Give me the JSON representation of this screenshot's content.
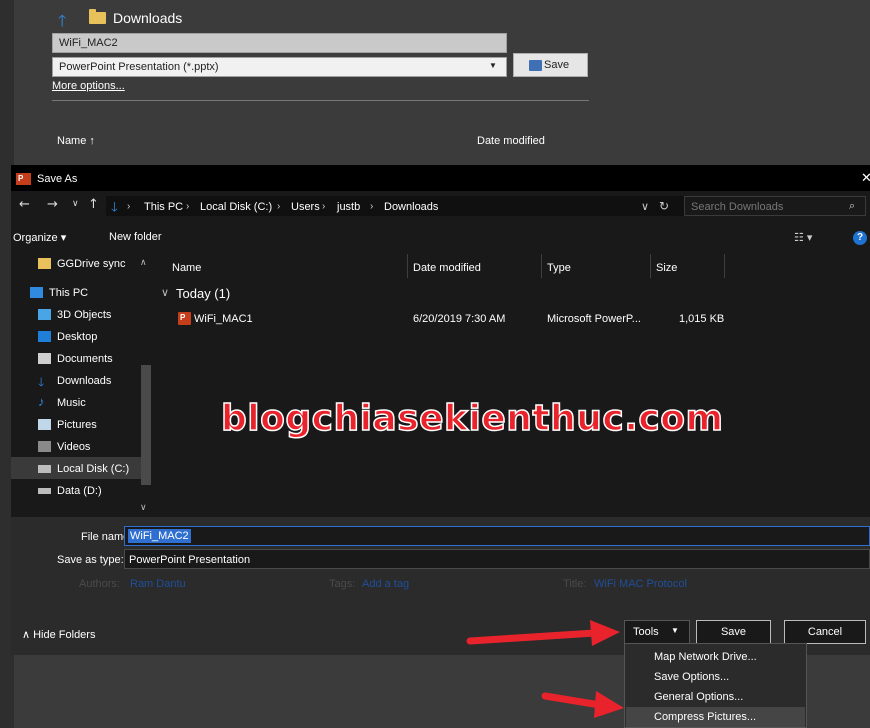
{
  "background": {
    "location": "Downloads",
    "file_name": "WiFi_MAC2",
    "file_type": "PowerPoint Presentation (*.pptx)",
    "save_label": "Save",
    "more_options": "More options...",
    "col_name": "Name ↑",
    "col_date": "Date modified"
  },
  "dialog": {
    "title": "Save As",
    "breadcrumb": [
      "This PC",
      "Local Disk (C:)",
      "Users",
      "justb",
      "Downloads"
    ],
    "search_placeholder": "Search Downloads",
    "organize_label": "Organize ▾",
    "new_folder_label": "New folder",
    "sidebar": [
      {
        "label": "GGDrive sync",
        "icon": "folder-icon",
        "color": "#e8c15a"
      },
      {
        "label": "This PC",
        "icon": "pc-icon",
        "color": "#2f8ae0"
      },
      {
        "label": "3D Objects",
        "icon": "cube-icon",
        "color": "#49a5e6"
      },
      {
        "label": "Desktop",
        "icon": "desktop-icon",
        "color": "#1e7ed8"
      },
      {
        "label": "Documents",
        "icon": "documents-icon",
        "color": "#cfcfcf"
      },
      {
        "label": "Downloads",
        "icon": "downloads-icon",
        "color": "#2f8ae0"
      },
      {
        "label": "Music",
        "icon": "music-icon",
        "color": "#2f8ae0"
      },
      {
        "label": "Pictures",
        "icon": "pictures-icon",
        "color": "#c0d7ea"
      },
      {
        "label": "Videos",
        "icon": "videos-icon",
        "color": "#8a8a8a"
      },
      {
        "label": "Local Disk (C:)",
        "icon": "disk-icon",
        "color": "#bcbcbc"
      },
      {
        "label": "Data (D:)",
        "icon": "drive-icon",
        "color": "#bcbcbc"
      }
    ],
    "columns": [
      "Name",
      "Date modified",
      "Type",
      "Size"
    ],
    "group": "Today (1)",
    "files": [
      {
        "name": "WiFi_MAC1",
        "date": "6/20/2019 7:30 AM",
        "type": "Microsoft PowerP...",
        "size": "1,015 KB"
      }
    ],
    "watermark": "blogchiasekienthuc.com",
    "file_name_label": "File name:",
    "file_name_value": "WiFi_MAC2",
    "save_type_label": "Save as type:",
    "save_type_value": "PowerPoint Presentation",
    "authors_label": "Authors:",
    "authors_value": "Ram Dantu",
    "tags_label": "Tags:",
    "tags_value": "Add a tag",
    "title_label": "Title:",
    "title_value": "WiFi MAC Protocol",
    "hide_folders": "∧  Hide Folders",
    "tools_label": "Tools",
    "save_label": "Save",
    "cancel_label": "Cancel",
    "tools_menu": [
      "Map Network Drive...",
      "Save Options...",
      "General Options...",
      "Compress Pictures..."
    ]
  },
  "colors": {
    "accent": "#2f6fd0",
    "arrow": "#e8232b",
    "ppt": "#c43e1c"
  }
}
